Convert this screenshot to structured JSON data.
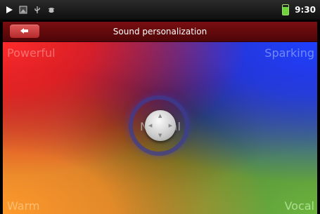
{
  "status_bar": {
    "icons": [
      "play-icon",
      "gallery-icon",
      "usb-icon",
      "debug-icon"
    ],
    "time": "9:30",
    "battery_color": "#6fd33b"
  },
  "header": {
    "title": "Sound personalization",
    "back_icon": "back-arrow-icon"
  },
  "pad": {
    "top_left_label": "Powerful",
    "top_right_label": "Sparking",
    "bottom_left_label": "Warm",
    "bottom_right_label": "Vocal",
    "center_label": "Normal",
    "colors": {
      "powerful": "#ff2b2b",
      "sparking": "#1f3fff",
      "warm": "#ff9a2a",
      "vocal": "#6bb43c"
    }
  }
}
